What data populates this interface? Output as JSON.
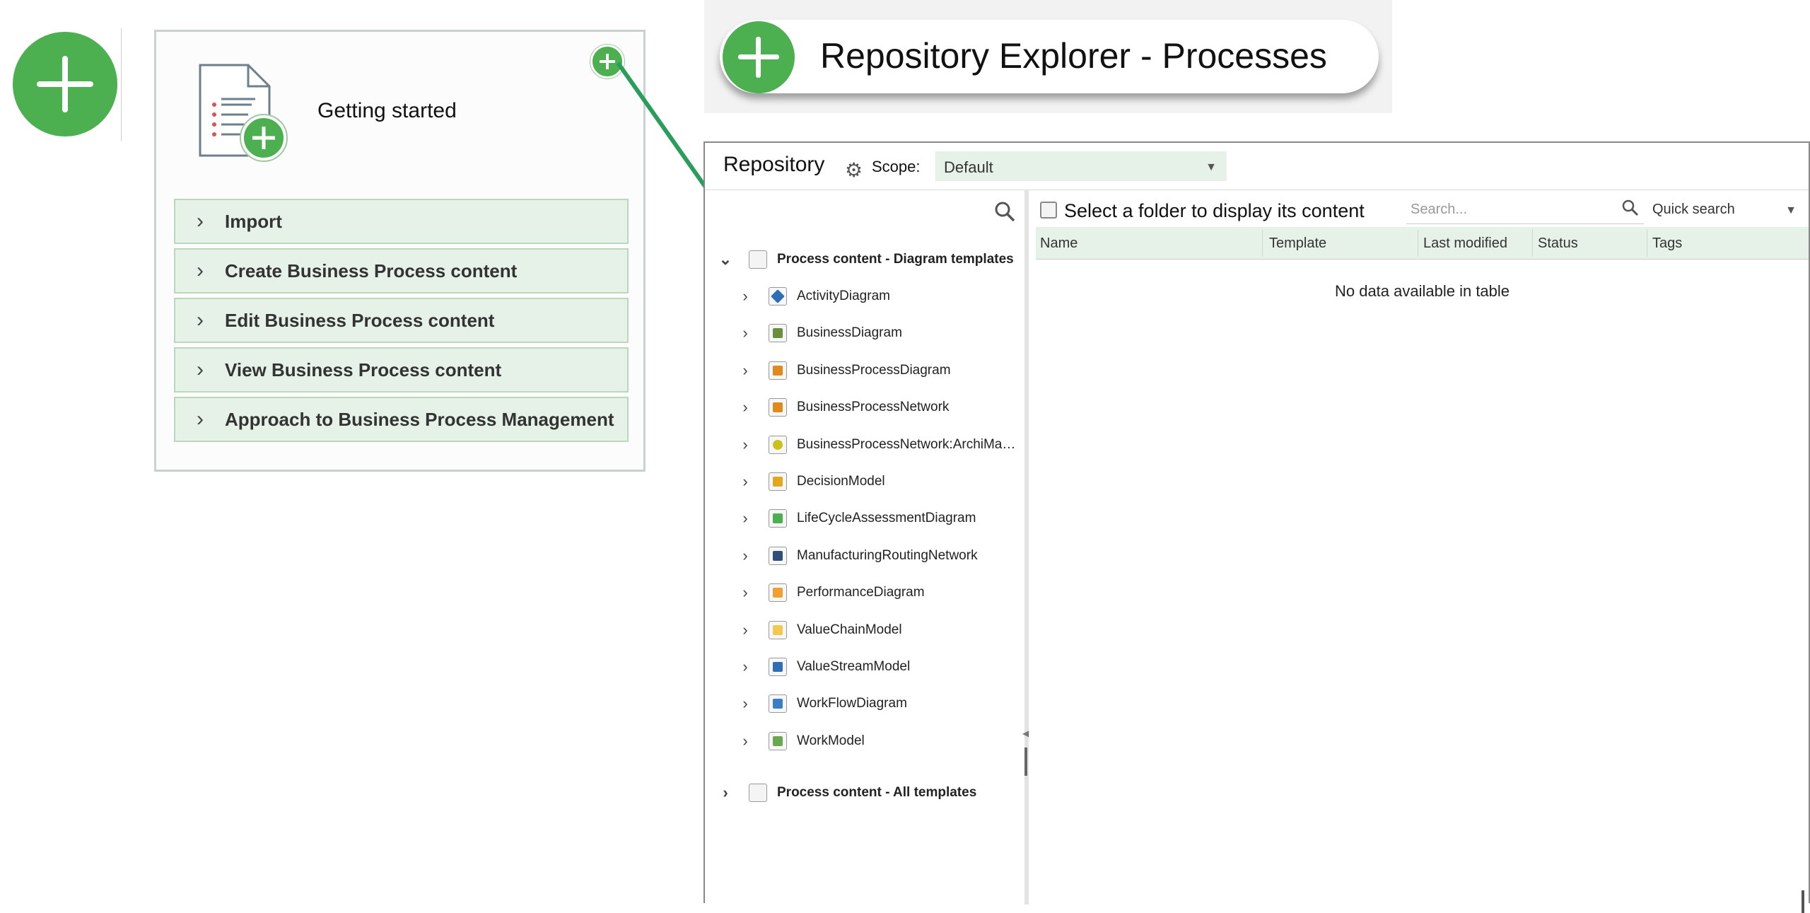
{
  "getting_started": {
    "title": "Getting started",
    "items": [
      {
        "label": "Import"
      },
      {
        "label": "Create Business Process content"
      },
      {
        "label": "Edit Business Process content"
      },
      {
        "label": "View Business Process content"
      },
      {
        "label": "Approach to Business Process Management"
      }
    ]
  },
  "banner": {
    "title": "Repository Explorer - Processes"
  },
  "repository": {
    "title": "Repository",
    "scope_label": "Scope:",
    "scope_value": "Default",
    "tree": {
      "root": "Process content - Diagram templates",
      "children": [
        {
          "label": "ActivityDiagram",
          "icon": "activity-diagram-icon",
          "color": "#2f6db5"
        },
        {
          "label": "BusinessDiagram",
          "icon": "business-diagram-icon",
          "color": "#6a8f3c"
        },
        {
          "label": "BusinessProcessDiagram",
          "icon": "business-process-diagram-icon",
          "color": "#e08a1e"
        },
        {
          "label": "BusinessProcessNetwork",
          "icon": "business-process-network-icon",
          "color": "#e08a1e"
        },
        {
          "label": "BusinessProcessNetwork:ArchiMa…",
          "icon": "archimate-network-icon",
          "color": "#c9c21a"
        },
        {
          "label": "DecisionModel",
          "icon": "decision-model-icon",
          "color": "#e0a81e"
        },
        {
          "label": "LifeCycleAssessmentDiagram",
          "icon": "lifecycle-assessment-icon",
          "color": "#4caf50"
        },
        {
          "label": "ManufacturingRoutingNetwork",
          "icon": "manufacturing-routing-icon",
          "color": "#2f4f7a"
        },
        {
          "label": "PerformanceDiagram",
          "icon": "performance-diagram-icon",
          "color": "#f0a030"
        },
        {
          "label": "ValueChainModel",
          "icon": "value-chain-model-icon",
          "color": "#f2c94c"
        },
        {
          "label": "ValueStreamModel",
          "icon": "value-stream-model-icon",
          "color": "#2f6db5"
        },
        {
          "label": "WorkFlowDiagram",
          "icon": "workflow-diagram-icon",
          "color": "#3a7fc4"
        },
        {
          "label": "WorkModel",
          "icon": "work-model-icon",
          "color": "#6aa84f"
        }
      ],
      "second_root": "Process content - All templates"
    },
    "content": {
      "title": "Select a folder to display its content",
      "search_placeholder": "Search...",
      "quick_search": "Quick search",
      "columns": [
        "Name",
        "Template",
        "Last modified",
        "Status",
        "Tags"
      ],
      "empty_message": "No data available in table"
    }
  },
  "colors": {
    "accent_green": "#4caf50",
    "light_green": "#e6f2e7"
  }
}
